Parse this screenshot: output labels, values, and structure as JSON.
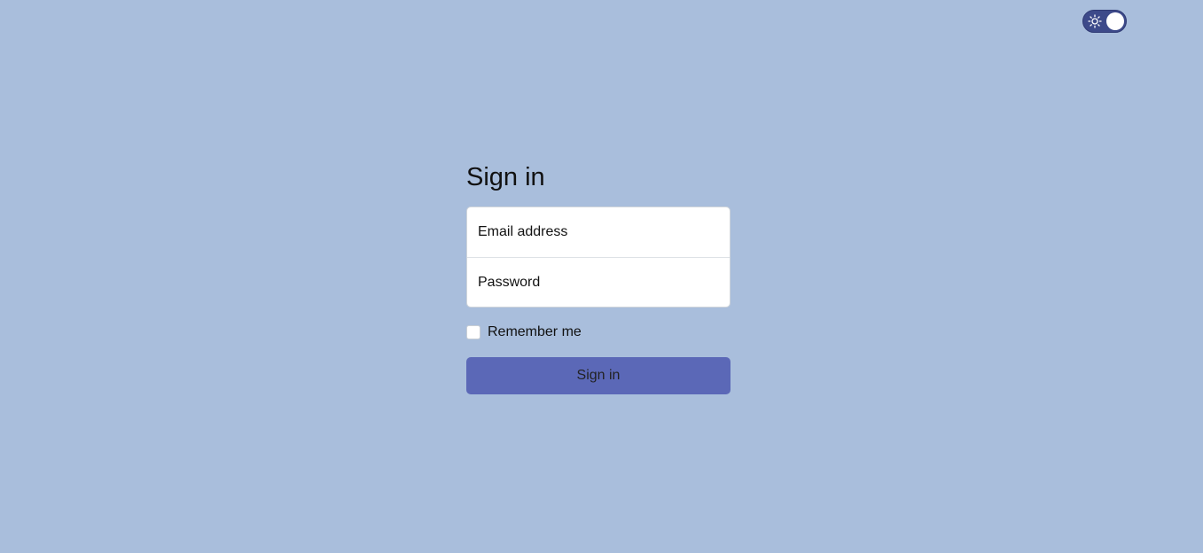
{
  "theme_toggle": {
    "icon": "sun-icon",
    "state": "on"
  },
  "signin": {
    "title": "Sign in",
    "email_placeholder": "Email address",
    "password_placeholder": "Password",
    "remember_label": "Remember me",
    "remember_checked": false,
    "submit_label": "Sign in"
  },
  "colors": {
    "background": "#a9bedc",
    "toggle_bg": "#3d4a8a",
    "button_bg": "#5b68b7"
  }
}
